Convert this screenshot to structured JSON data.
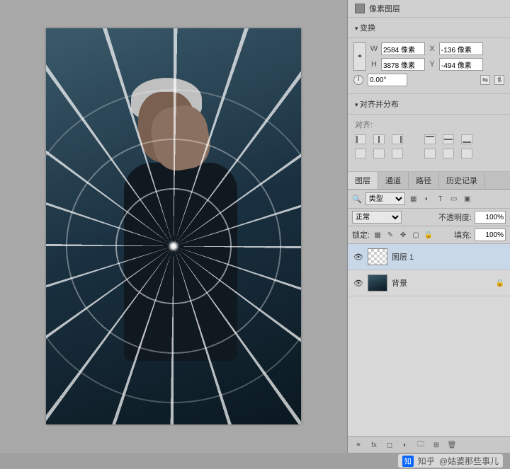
{
  "properties": {
    "pixel_layer_label": "像素图层",
    "transform_header": "变换",
    "W_label": "W",
    "W_value": "2584 像素",
    "H_label": "H",
    "H_value": "3878 像素",
    "X_label": "X",
    "X_value": "-136 像素",
    "Y_label": "Y",
    "Y_value": "-494 像素",
    "angle_value": "0.00°",
    "align_header": "对齐并分布",
    "align_label": "对齐:"
  },
  "layers_panel": {
    "tabs": [
      "图层",
      "通道",
      "路径",
      "历史记录"
    ],
    "active_tab": 0,
    "filter_kind": "类型",
    "blend_mode": "正常",
    "opacity_label": "不透明度:",
    "opacity_value": "100%",
    "lock_label": "锁定:",
    "fill_label": "填充:",
    "fill_value": "100%",
    "layers": [
      {
        "name": "图层 1",
        "locked": false
      },
      {
        "name": "背景",
        "locked": true
      }
    ]
  },
  "watermark": {
    "logo": "知",
    "source": "知乎",
    "author": "@姑婆那些事儿"
  }
}
